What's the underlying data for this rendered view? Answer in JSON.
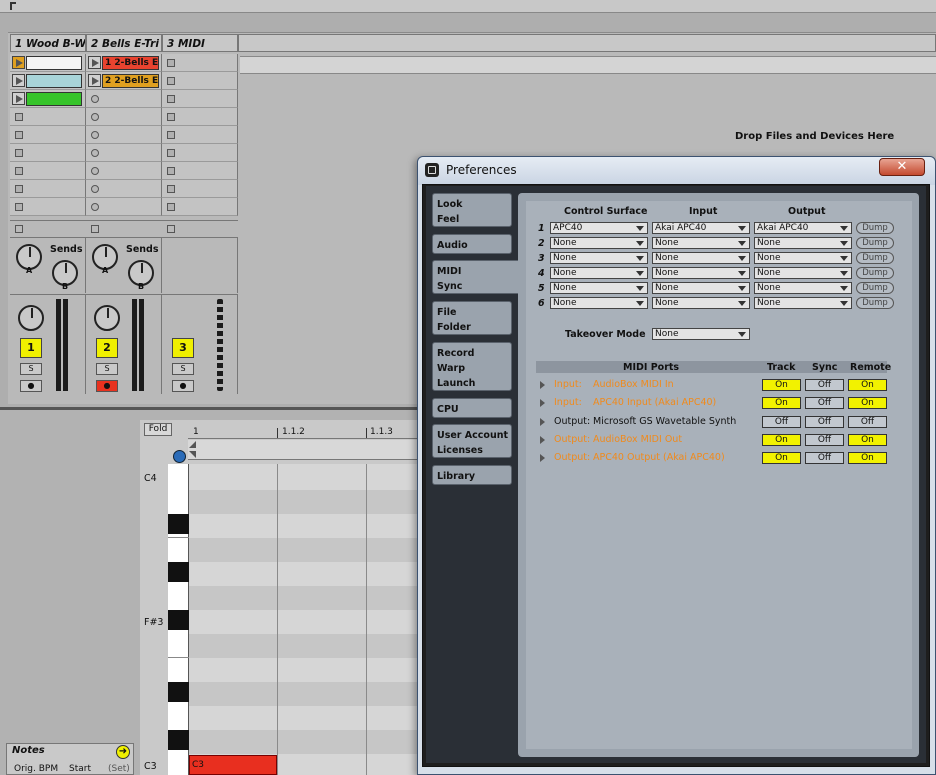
{
  "session": {
    "tracks": [
      {
        "name": "1 Wood B-W",
        "number": "1"
      },
      {
        "name": "2 Bells E-Tri",
        "number": "2"
      },
      {
        "name": "3 MIDI",
        "number": "3"
      }
    ],
    "clips": [
      {
        "label": "1 2-Bells E-",
        "color": "#e8432f"
      },
      {
        "label": "2 2-Bells E-",
        "color": "#e0a020"
      }
    ],
    "sends_label": "Sends",
    "knob_a": "A",
    "knob_b": "B",
    "solo_label": "S",
    "drop_text": "Drop Files and Devices Here"
  },
  "editor": {
    "fold_label": "Fold",
    "ruler": [
      "1",
      "1.1.2",
      "1.1.3"
    ],
    "note_labels": [
      "C4",
      "F#3",
      "C3"
    ],
    "midi_note_label": "C3",
    "notes_title": "Notes",
    "notes_sub": [
      "Orig. BPM",
      "Start",
      "(Set)"
    ]
  },
  "prefs": {
    "title": "Preferences",
    "close_glyph": "✕",
    "tabs": [
      {
        "lines": [
          "Look",
          "Feel"
        ]
      },
      {
        "lines": [
          "Audio"
        ]
      },
      {
        "lines": [
          "MIDI",
          "Sync"
        ]
      },
      {
        "lines": [
          "File",
          "Folder"
        ]
      },
      {
        "lines": [
          "Record",
          "Warp",
          "Launch"
        ]
      },
      {
        "lines": [
          "CPU"
        ]
      },
      {
        "lines": [
          "User Account",
          "Licenses"
        ]
      },
      {
        "lines": [
          "Library"
        ]
      }
    ],
    "surface_headers": [
      "Control Surface",
      "Input",
      "Output"
    ],
    "surfaces": [
      {
        "n": "1",
        "surface": "APC40",
        "input": "Akai APC40",
        "output": "Akai APC40",
        "dump": "Dump"
      },
      {
        "n": "2",
        "surface": "None",
        "input": "None",
        "output": "None",
        "dump": "Dump"
      },
      {
        "n": "3",
        "surface": "None",
        "input": "None",
        "output": "None",
        "dump": "Dump"
      },
      {
        "n": "4",
        "surface": "None",
        "input": "None",
        "output": "None",
        "dump": "Dump"
      },
      {
        "n": "5",
        "surface": "None",
        "input": "None",
        "output": "None",
        "dump": "Dump"
      },
      {
        "n": "6",
        "surface": "None",
        "input": "None",
        "output": "None",
        "dump": "Dump"
      }
    ],
    "takeover_label": "Takeover Mode",
    "takeover_value": "None",
    "ports_headers": [
      "MIDI Ports",
      "Track",
      "Sync",
      "Remote"
    ],
    "ports": [
      {
        "dir": "Input:",
        "name": "AudioBox MIDI In",
        "track": "On",
        "sync": "Off",
        "remote": "On",
        "active": true
      },
      {
        "dir": "Input:",
        "name": "APC40 Input (Akai APC40)",
        "track": "On",
        "sync": "Off",
        "remote": "On",
        "active": true
      },
      {
        "dir": "Output:",
        "name": "Microsoft GS Wavetable Synth",
        "track": "Off",
        "sync": "Off",
        "remote": "Off",
        "active": false
      },
      {
        "dir": "Output:",
        "name": "AudioBox MIDI Out",
        "track": "On",
        "sync": "Off",
        "remote": "On",
        "active": true
      },
      {
        "dir": "Output:",
        "name": "APC40 Output (Akai APC40)",
        "track": "On",
        "sync": "Off",
        "remote": "On",
        "active": true
      }
    ]
  }
}
